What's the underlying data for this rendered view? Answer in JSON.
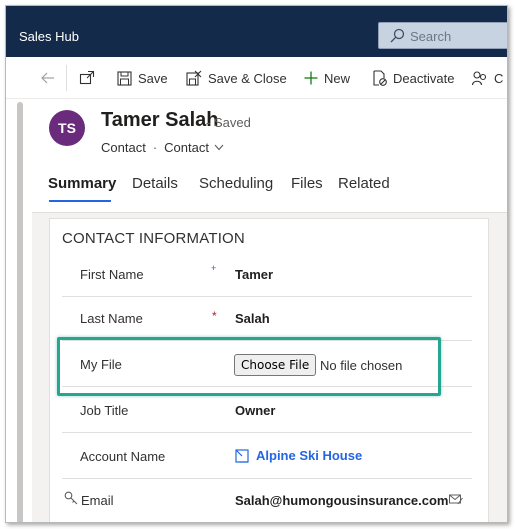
{
  "app": {
    "title": "Sales Hub"
  },
  "search": {
    "placeholder": "Search"
  },
  "toolbar": {
    "save_label": "Save",
    "save_close_label": "Save & Close",
    "new_label": "New",
    "deactivate_label": "Deactivate",
    "truncated_label": "C"
  },
  "record": {
    "initials": "TS",
    "name": "Tamer Salah",
    "status": "- Saved",
    "entity": "Contact",
    "form": "Contact"
  },
  "tabs": [
    {
      "label": "Summary",
      "active": true
    },
    {
      "label": "Details"
    },
    {
      "label": "Scheduling"
    },
    {
      "label": "Files"
    },
    {
      "label": "Related"
    }
  ],
  "section": {
    "title": "CONTACT INFORMATION",
    "fields": [
      {
        "label": "First Name",
        "value": "Tamer",
        "required": "+"
      },
      {
        "label": "Last Name",
        "value": "Salah",
        "required": "*"
      },
      {
        "label": "My File",
        "button": "Choose File",
        "status": "No file chosen"
      },
      {
        "label": "Job Title",
        "value": "Owner"
      },
      {
        "label": "Account Name",
        "value": "Alpine Ski House"
      },
      {
        "label": "Email",
        "value": "Salah@humongousinsurance.com"
      }
    ]
  },
  "colors": {
    "topbar": "#142a4a",
    "accent": "#2266e3",
    "avatar": "#6b2b7d",
    "highlight": "#26a690",
    "required": "#a4262c"
  },
  "icons": [
    "search-icon",
    "back-arrow-icon",
    "popout-icon",
    "save-icon",
    "save-close-icon",
    "plus-icon",
    "deactivate-icon",
    "chevron-down-icon",
    "account-icon",
    "key-icon",
    "email-compose-icon"
  ]
}
